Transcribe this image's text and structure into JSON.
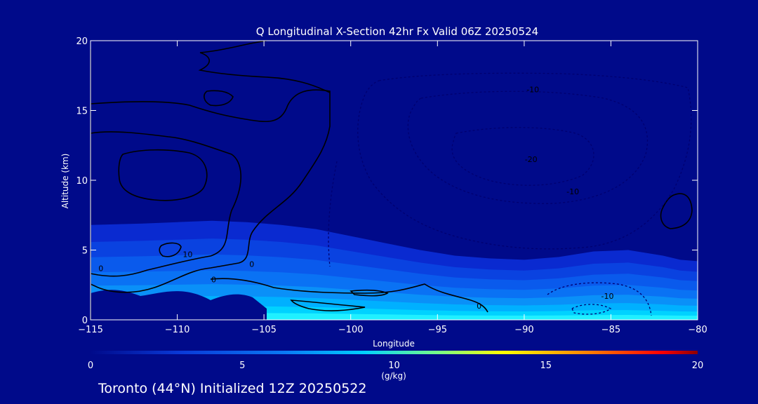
{
  "chart_data": {
    "type": "contour",
    "title": "Q Longitudinal X-Section 42hr  Fx Valid 06Z 20250524",
    "xlabel": "Longitude",
    "ylabel": "Altitude (km)",
    "xlim": [
      -115,
      -80
    ],
    "ylim": [
      0,
      20
    ],
    "x_ticks": [
      -115,
      -110,
      -105,
      -100,
      -95,
      -90,
      -85,
      -80
    ],
    "x_tick_labels": [
      "−115",
      "−110",
      "−105",
      "−100",
      "−95",
      "−90",
      "−85",
      "−80"
    ],
    "y_ticks": [
      0,
      5,
      10,
      15,
      20
    ],
    "y_tick_labels": [
      "0",
      "5",
      "10",
      "15",
      "20"
    ],
    "filled_field": {
      "variable": "Q",
      "units": "(g/kg)",
      "colorbar_range": [
        0,
        20
      ],
      "colorbar_ticks": [
        0,
        5,
        10,
        15,
        20
      ],
      "colorbar_tick_labels": [
        "0",
        "5",
        "10",
        "15",
        "20"
      ],
      "colors": [
        "#0a28c8",
        "#0a6af0",
        "#00c8ff",
        "#7fff80",
        "#ffff00",
        "#ff7f00",
        "#ff0000",
        "#8b0000"
      ],
      "moist_layer_top_km": [
        6.8,
        6.9,
        7.0,
        7.1,
        7.0,
        6.8,
        6.5,
        6.0,
        5.5,
        5.0,
        4.6,
        4.4,
        4.3,
        4.5,
        4.9,
        5.0,
        4.6,
        4.3,
        4.2
      ],
      "moist_layer_x": [
        -115,
        -112,
        -110,
        -108,
        -106,
        -104,
        -102,
        -100,
        -98,
        -96,
        -94,
        -92,
        -90,
        -88,
        -86,
        -84,
        -82,
        -81,
        -80
      ]
    },
    "contour_labels": [
      {
        "text": "-10",
        "lon": -89.5,
        "alt": 16.3
      },
      {
        "text": "-20",
        "lon": -89.6,
        "alt": 11.3
      },
      {
        "text": "-10",
        "lon": -87.2,
        "alt": 9.0
      },
      {
        "text": "0",
        "lon": -105.7,
        "alt": 3.8
      },
      {
        "text": "0",
        "lon": -107.9,
        "alt": 2.7
      },
      {
        "text": "0",
        "lon": -92.6,
        "alt": 0.8
      },
      {
        "text": "10",
        "lon": -109.4,
        "alt": 4.5
      },
      {
        "text": "0",
        "lon": -114.4,
        "alt": 3.5
      },
      {
        "text": "-10",
        "lon": -85.2,
        "alt": 1.5
      }
    ]
  },
  "footer": {
    "station_text": "Toronto (44°N) Initialized 12Z 20250522"
  },
  "colors": {
    "background": "#000a8a",
    "axis": "#ffffff",
    "contour_solid": "#000000",
    "contour_dashed": "#000060"
  }
}
